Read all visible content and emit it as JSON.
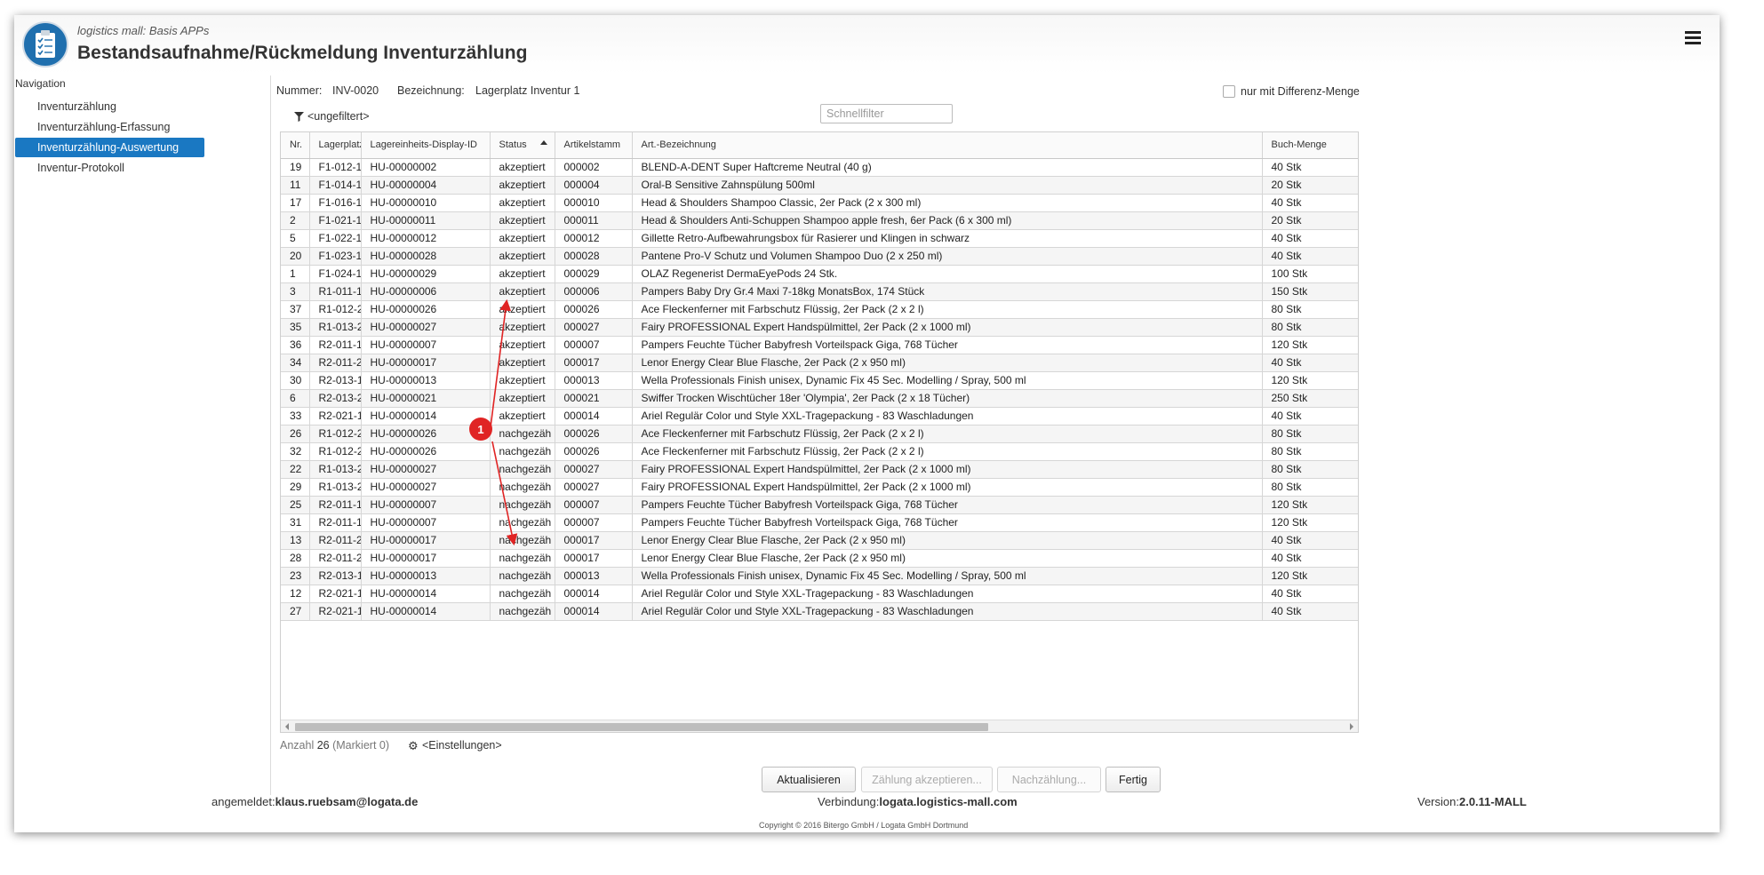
{
  "app": {
    "subtitle": "logistics mall: Basis APPs",
    "title": "Bestandsaufnahme/Rückmeldung Inventurzählung"
  },
  "nav": {
    "heading": "Navigation",
    "items": [
      {
        "label": "Inventurzählung",
        "active": false
      },
      {
        "label": "Inventurzählung-Erfassung",
        "active": false
      },
      {
        "label": "Inventurzählung-Auswertung",
        "active": true
      },
      {
        "label": "Inventur-Protokoll",
        "active": false
      }
    ]
  },
  "info": {
    "nummer_label": "Nummer:",
    "nummer_value": "INV-0020",
    "bezeichnung_label": "Bezeichnung:",
    "bezeichnung_value": "Lagerplatz Inventur 1",
    "diff_checkbox_label": "nur mit Differenz-Menge"
  },
  "filter": {
    "label": "<ungefiltert>",
    "quick_placeholder": "Schnellfilter"
  },
  "table": {
    "columns": [
      "Nr.",
      "Lagerplatz",
      "Lagereinheits-Display-ID",
      "Status",
      "Artikelstamm",
      "Art.-Bezeichnung",
      "Buch-Menge"
    ],
    "sorted_column": "Status",
    "rows": [
      [
        "19",
        "F1-012-1",
        "HU-00000002",
        "akzeptiert",
        "000002",
        "BLEND-A-DENT Super Haftcreme Neutral (40 g)",
        "40 Stk"
      ],
      [
        "11",
        "F1-014-1",
        "HU-00000004",
        "akzeptiert",
        "000004",
        "Oral-B Sensitive Zahnspülung 500ml",
        "20 Stk"
      ],
      [
        "17",
        "F1-016-1",
        "HU-00000010",
        "akzeptiert",
        "000010",
        "Head & Shoulders Shampoo Classic, 2er Pack (2 x 300 ml)",
        "40 Stk"
      ],
      [
        "2",
        "F1-021-1",
        "HU-00000011",
        "akzeptiert",
        "000011",
        "Head & Shoulders Anti-Schuppen Shampoo apple fresh, 6er Pack (6 x 300 ml)",
        "20 Stk"
      ],
      [
        "5",
        "F1-022-1",
        "HU-00000012",
        "akzeptiert",
        "000012",
        "Gillette Retro-Aufbewahrungsbox für Rasierer und Klingen in schwarz",
        "40 Stk"
      ],
      [
        "20",
        "F1-023-1",
        "HU-00000028",
        "akzeptiert",
        "000028",
        "Pantene Pro-V Schutz und Volumen Shampoo Duo (2 x 250 ml)",
        "40 Stk"
      ],
      [
        "1",
        "F1-024-1",
        "HU-00000029",
        "akzeptiert",
        "000029",
        "OLAZ Regenerist DermaEyePods 24 Stk.",
        "100 Stk"
      ],
      [
        "3",
        "R1-011-1",
        "HU-00000006",
        "akzeptiert",
        "000006",
        "Pampers Baby Dry Gr.4 Maxi 7-18kg MonatsBox, 174 Stück",
        "150 Stk"
      ],
      [
        "37",
        "R1-012-2",
        "HU-00000026",
        "akzeptiert",
        "000026",
        "Ace Fleckenferner mit Farbschutz Flüssig, 2er Pack (2 x 2 l)",
        "80 Stk"
      ],
      [
        "35",
        "R1-013-2",
        "HU-00000027",
        "akzeptiert",
        "000027",
        "Fairy PROFESSIONAL Expert Handspülmittel, 2er Pack (2 x 1000 ml)",
        "80 Stk"
      ],
      [
        "36",
        "R2-011-1",
        "HU-00000007",
        "akzeptiert",
        "000007",
        "Pampers Feuchte Tücher Babyfresh Vorteilspack Giga, 768 Tücher",
        "120 Stk"
      ],
      [
        "34",
        "R2-011-2",
        "HU-00000017",
        "akzeptiert",
        "000017",
        "Lenor Energy Clear Blue Flasche, 2er Pack (2 x 950 ml)",
        "40 Stk"
      ],
      [
        "30",
        "R2-013-1",
        "HU-00000013",
        "akzeptiert",
        "000013",
        "Wella Professionals Finish unisex, Dynamic Fix 45 Sec. Modelling / Spray, 500 ml",
        "120 Stk"
      ],
      [
        "6",
        "R2-013-2",
        "HU-00000021",
        "akzeptiert",
        "000021",
        "Swiffer Trocken Wischtücher 18er 'Olympia', 2er Pack (2 x 18 Tücher)",
        "250 Stk"
      ],
      [
        "33",
        "R2-021-1",
        "HU-00000014",
        "akzeptiert",
        "000014",
        "Ariel Regulär Color und Style XXL-Tragepackung - 83 Waschladungen",
        "40 Stk"
      ],
      [
        "26",
        "R1-012-2",
        "HU-00000026",
        "nachgezäh",
        "000026",
        "Ace Fleckenferner mit Farbschutz Flüssig, 2er Pack (2 x 2 l)",
        "80 Stk"
      ],
      [
        "32",
        "R1-012-2",
        "HU-00000026",
        "nachgezäh",
        "000026",
        "Ace Fleckenferner mit Farbschutz Flüssig, 2er Pack (2 x 2 l)",
        "80 Stk"
      ],
      [
        "22",
        "R1-013-2",
        "HU-00000027",
        "nachgezäh",
        "000027",
        "Fairy PROFESSIONAL Expert Handspülmittel, 2er Pack (2 x 1000 ml)",
        "80 Stk"
      ],
      [
        "29",
        "R1-013-2",
        "HU-00000027",
        "nachgezäh",
        "000027",
        "Fairy PROFESSIONAL Expert Handspülmittel, 2er Pack (2 x 1000 ml)",
        "80 Stk"
      ],
      [
        "25",
        "R2-011-1",
        "HU-00000007",
        "nachgezäh",
        "000007",
        "Pampers Feuchte Tücher Babyfresh Vorteilspack Giga, 768 Tücher",
        "120 Stk"
      ],
      [
        "31",
        "R2-011-1",
        "HU-00000007",
        "nachgezäh",
        "000007",
        "Pampers Feuchte Tücher Babyfresh Vorteilspack Giga, 768 Tücher",
        "120 Stk"
      ],
      [
        "13",
        "R2-011-2",
        "HU-00000017",
        "nachgezäh",
        "000017",
        "Lenor Energy Clear Blue Flasche, 2er Pack (2 x 950 ml)",
        "40 Stk"
      ],
      [
        "28",
        "R2-011-2",
        "HU-00000017",
        "nachgezäh",
        "000017",
        "Lenor Energy Clear Blue Flasche, 2er Pack (2 x 950 ml)",
        "40 Stk"
      ],
      [
        "23",
        "R2-013-1",
        "HU-00000013",
        "nachgezäh",
        "000013",
        "Wella Professionals Finish unisex, Dynamic Fix 45 Sec. Modelling / Spray, 500 ml",
        "120 Stk"
      ],
      [
        "12",
        "R2-021-1",
        "HU-00000014",
        "nachgezäh",
        "000014",
        "Ariel Regulär Color und Style XXL-Tragepackung - 83 Waschladungen",
        "40 Stk"
      ],
      [
        "27",
        "R2-021-1",
        "HU-00000014",
        "nachgezäh",
        "000014",
        "Ariel Regulär Color und Style XXL-Tragepackung - 83 Waschladungen",
        "40 Stk"
      ]
    ]
  },
  "status_bar": {
    "count_label": "Anzahl",
    "count_value": "26",
    "marked_label": "(Markiert 0)",
    "settings_label": "<Einstellungen>"
  },
  "buttons": {
    "refresh": "Aktualisieren",
    "accept": "Zählung akzeptieren...",
    "recount": "Nachzählung...",
    "done": "Fertig"
  },
  "footer": {
    "user_label": "angemeldet:",
    "user_value": "klaus.ruebsam@logata.de",
    "conn_label": "Verbindung:",
    "conn_value": "logata.logistics-mall.com",
    "version_label": "Version:",
    "version_value": "2.0.11-MALL",
    "copyright": "Copyright © 2016 Bitergo GmbH / Logata GmbH Dortmund"
  },
  "annotation": {
    "marker": "1",
    "color": "#e02424"
  },
  "colors": {
    "accent": "#1a78c2"
  }
}
